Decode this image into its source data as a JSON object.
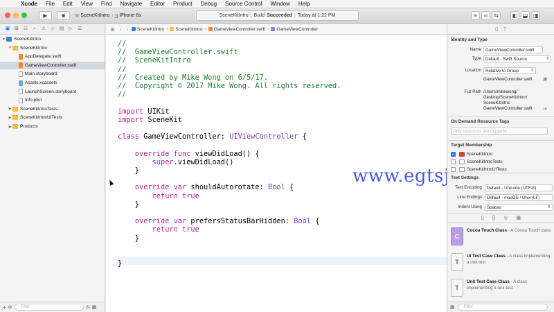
{
  "menubar": {
    "apple": "",
    "items": [
      "Xcode",
      "File",
      "Edit",
      "View",
      "Find",
      "Navigate",
      "Editor",
      "Product",
      "Debug",
      "Source Control",
      "Window",
      "Help"
    ]
  },
  "toolbar": {
    "scheme_name": "SceneKitIntro",
    "device": "iPhone 6s",
    "activity_project": "SceneKitIntro",
    "activity_status_prefix": "Build",
    "activity_status": "Succeeded",
    "activity_time": "Today at 1:22 PM"
  },
  "navigator": {
    "items": [
      {
        "label": "SceneKitIntro",
        "depth": 0,
        "kind": "proj",
        "disclosure": "▼",
        "selected": false
      },
      {
        "label": "SceneKitIntro",
        "depth": 1,
        "kind": "folder",
        "disclosure": "▼",
        "selected": false
      },
      {
        "label": "AppDelegate.swift",
        "depth": 2,
        "kind": "swift",
        "disclosure": "",
        "selected": false
      },
      {
        "label": "GameViewController.swift",
        "depth": 2,
        "kind": "swift",
        "disclosure": "",
        "selected": true
      },
      {
        "label": "Main.storyboard",
        "depth": 2,
        "kind": "file",
        "disclosure": "",
        "selected": false
      },
      {
        "label": "Assets.xcassets",
        "depth": 2,
        "kind": "assets",
        "disclosure": "",
        "selected": false
      },
      {
        "label": "LaunchScreen.storyboard",
        "depth": 2,
        "kind": "file",
        "disclosure": "",
        "selected": false
      },
      {
        "label": "Info.plist",
        "depth": 2,
        "kind": "file",
        "disclosure": "",
        "selected": false
      },
      {
        "label": "SceneKitIntroTests",
        "depth": 1,
        "kind": "folder",
        "disclosure": "▶",
        "selected": false
      },
      {
        "label": "SceneKitIntroUITests",
        "depth": 1,
        "kind": "folder",
        "disclosure": "▶",
        "selected": false
      },
      {
        "label": "Products",
        "depth": 1,
        "kind": "folder",
        "disclosure": "▶",
        "selected": false
      }
    ],
    "filter_placeholder": "Filter"
  },
  "jumpbar": {
    "crumbs": [
      "SceneKitIntro",
      "SceneKitIntro",
      "GameViewController.swift",
      "GameViewController"
    ]
  },
  "code": {
    "lines": [
      [
        [
          "c-com",
          "//"
        ]
      ],
      [
        [
          "c-com",
          "//  GameViewController.swift"
        ]
      ],
      [
        [
          "c-com",
          "//  SceneKitIntro"
        ]
      ],
      [
        [
          "c-com",
          "//"
        ]
      ],
      [
        [
          "c-com",
          "//  Created by Mike Wong on 6/5/17."
        ]
      ],
      [
        [
          "c-com",
          "//  Copyright © 2017 Mike Wong. All rights reserved."
        ]
      ],
      [
        [
          "c-com",
          "//"
        ]
      ],
      [],
      [
        [
          "c-kw",
          "import"
        ],
        [
          "c-plain",
          " UIKit"
        ]
      ],
      [
        [
          "c-kw",
          "import"
        ],
        [
          "c-plain",
          " SceneKit"
        ]
      ],
      [],
      [
        [
          "c-kw",
          "class"
        ],
        [
          "c-plain",
          " GameViewController: "
        ],
        [
          "c-type",
          "UIViewController"
        ],
        [
          "c-plain",
          " {"
        ]
      ],
      [],
      [
        [
          "c-plain",
          "    "
        ],
        [
          "c-kw",
          "override func"
        ],
        [
          "c-plain",
          " viewDidLoad() {"
        ]
      ],
      [
        [
          "c-plain",
          "        "
        ],
        [
          "c-kw",
          "super"
        ],
        [
          "c-plain",
          ".viewDidLoad()"
        ]
      ],
      [
        [
          "c-plain",
          "    }"
        ]
      ],
      [],
      [
        [
          "c-plain",
          "    "
        ],
        [
          "c-kw",
          "override var"
        ],
        [
          "c-plain",
          " shouldAutorotate: "
        ],
        [
          "c-type",
          "Bool"
        ],
        [
          "c-plain",
          " {"
        ]
      ],
      [
        [
          "c-plain",
          "        "
        ],
        [
          "c-kw",
          "return true"
        ]
      ],
      [
        [
          "c-plain",
          "    }"
        ]
      ],
      [],
      [
        [
          "c-plain",
          "    "
        ],
        [
          "c-kw",
          "override var"
        ],
        [
          "c-plain",
          " prefersStatusBarHidden: "
        ],
        [
          "c-type",
          "Bool"
        ],
        [
          "c-plain",
          " {"
        ]
      ],
      [
        [
          "c-plain",
          "        "
        ],
        [
          "c-kw",
          "return true"
        ]
      ],
      [
        [
          "c-plain",
          "    }"
        ]
      ],
      [],
      [],
      [
        [
          "c-plain",
          "}"
        ]
      ]
    ]
  },
  "watermark": "www.egtsj.com",
  "inspector": {
    "identity_title": "Identity and Type",
    "name_label": "Name",
    "name_value": "GameViewController.swift",
    "type_label": "Type",
    "type_value": "Default - Swift Source",
    "location_label": "Location",
    "location_value": "Relative to Group",
    "location_file": "GameViewController.swift",
    "fullpath_label": "Full Path",
    "fullpath_lines": [
      "/Users/mikewong/",
      "Desktop/SceneKitIntro/",
      "SceneKitIntro/",
      "GameViewController.swift"
    ],
    "tags_title": "On Demand Resource Tags",
    "tags_placeholder": "Only resources are taggable",
    "membership_title": "Target Membership",
    "targets": [
      {
        "name": "SceneKitIntro",
        "checked": true
      },
      {
        "name": "SceneKitIntroTests",
        "checked": false
      },
      {
        "name": "SceneKitIntroUITests",
        "checked": false
      }
    ],
    "text_title": "Text Settings",
    "encoding_label": "Text Encoding",
    "encoding_value": "Default - Unicode (UTF-8)",
    "endings_label": "Line Endings",
    "endings_value": "Default - macOS / Unix (LF)",
    "indent_label": "Indent Using",
    "indent_value": "Spaces",
    "library": [
      {
        "icon": "C",
        "kind": "c",
        "title": "Cocoa Touch Class",
        "desc": "- A Cocoa Touch class"
      },
      {
        "icon": "T",
        "kind": "t",
        "title": "UI Test Case Class",
        "desc": "- A class implementing a unit test"
      },
      {
        "icon": "T",
        "kind": "t",
        "title": "Unit Test Case Class",
        "desc": "- A class implementing a unit test"
      }
    ],
    "filter_placeholder": "Filter"
  }
}
